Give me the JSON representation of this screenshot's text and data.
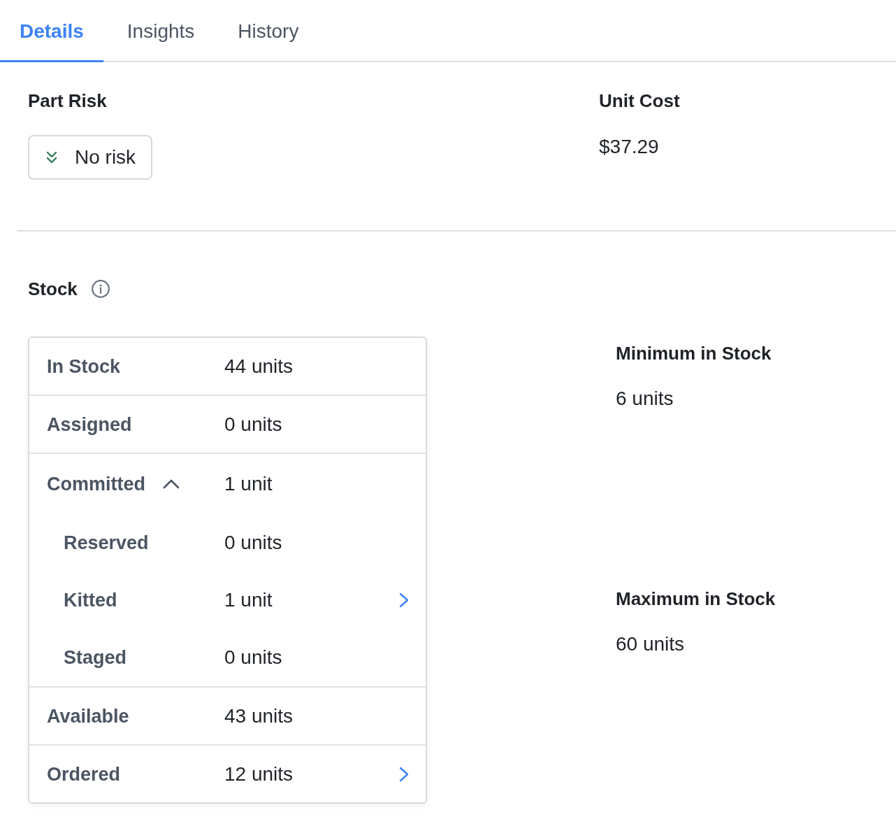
{
  "tabs": [
    {
      "label": "Details",
      "selected": true
    },
    {
      "label": "Insights",
      "selected": false
    },
    {
      "label": "History",
      "selected": false
    }
  ],
  "part_risk": {
    "heading": "Part Risk",
    "button": {
      "label": "No risk"
    }
  },
  "unit_cost": {
    "heading": "Unit Cost",
    "value": "$37.29"
  },
  "stock": {
    "heading": "Stock",
    "rows": [
      {
        "kind": "item",
        "label": "In Stock",
        "value": "44 units",
        "navigable": false
      },
      {
        "kind": "item",
        "label": "Assigned",
        "value": "0 units",
        "navigable": false
      },
      {
        "kind": "group",
        "label": "Committed",
        "value": "1 unit",
        "expanded": true,
        "children": [
          {
            "label": "Reserved",
            "value": "0 units",
            "navigable": false
          },
          {
            "label": "Kitted",
            "value": "1 unit",
            "navigable": true
          },
          {
            "label": "Staged",
            "value": "0 units",
            "navigable": false
          }
        ]
      },
      {
        "kind": "item",
        "label": "Available",
        "value": "43 units",
        "navigable": false
      },
      {
        "kind": "item",
        "label": "Ordered",
        "value": "12 units",
        "navigable": true
      }
    ]
  },
  "minimum": {
    "heading": "Minimum in Stock",
    "value": "6 units"
  },
  "maximum": {
    "heading": "Maximum in Stock",
    "value": "60 units"
  }
}
